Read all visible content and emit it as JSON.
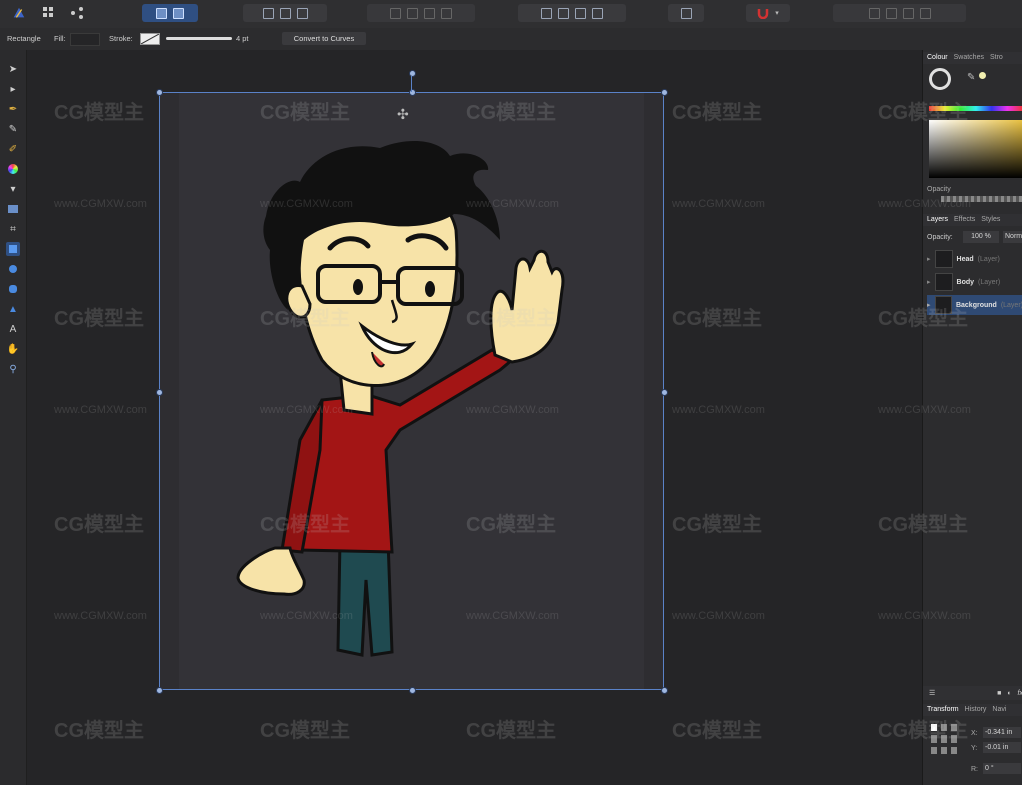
{
  "context_toolbar": {
    "tool_name": "Rectangle",
    "fill_label": "Fill:",
    "stroke_label": "Stroke:",
    "stroke_width": "4 pt",
    "convert_button": "Convert to Curves"
  },
  "right_panel": {
    "colour_tabs": [
      "Colour",
      "Swatches",
      "Stro"
    ],
    "opacity_label": "Opacity",
    "layer_tabs": [
      "Layers",
      "Effects",
      "Styles"
    ],
    "layer_opacity_label": "Opacity:",
    "layer_opacity_value": "100 %",
    "blend_mode": "Norm",
    "layers": [
      {
        "name": "Head",
        "type": "(Layer)"
      },
      {
        "name": "Body",
        "type": "(Layer)"
      },
      {
        "name": "Background",
        "type": "(Layer)"
      }
    ],
    "bottom_tabs": [
      "Transform",
      "History",
      "Navi"
    ],
    "transform": {
      "x_label": "X:",
      "x_value": "-0.341 in",
      "y_label": "Y:",
      "y_value": "-0.01 in",
      "r_label": "R:",
      "r_value": "0 °"
    }
  },
  "watermark": {
    "brand": "CG模型主",
    "url": "www.CGMXW.com"
  },
  "colors": {
    "accent": "#2f4f82",
    "selection": "#5a82c8",
    "shirt": "#a31515",
    "skin": "#f7e3a8",
    "pants": "#1f4a50"
  }
}
